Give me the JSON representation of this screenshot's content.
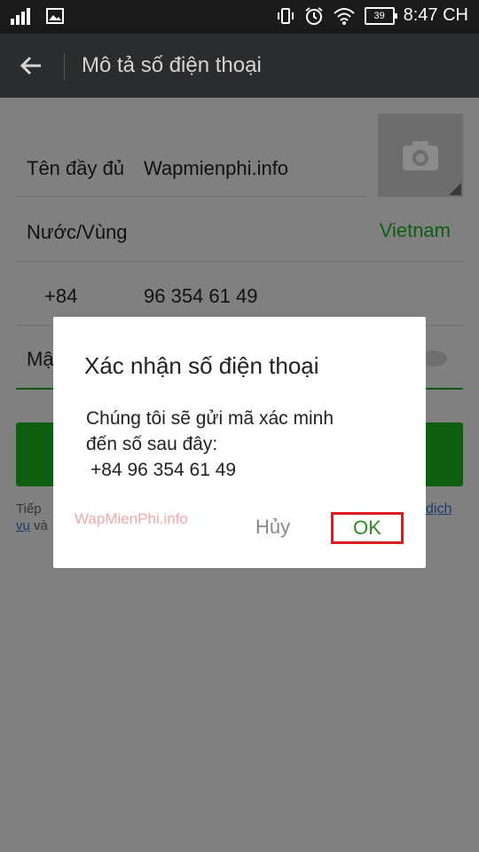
{
  "statusbar": {
    "time": "8:47 CH",
    "battery": "39",
    "icons": [
      "signal-icon",
      "image-icon",
      "vibrate-icon",
      "alarm-icon",
      "wifi-icon",
      "battery-icon"
    ]
  },
  "appbar": {
    "title": "Mô tả số điện thoại",
    "back_icon": "arrow-left-icon"
  },
  "form": {
    "fullname_label": "Tên đầy đủ",
    "fullname_value": "Wapmienphi.info",
    "country_label": "Nước/Vùng",
    "country_value": "Vietnam",
    "dial_code": "+84",
    "phone_value": "96 354 61 49",
    "password_label_partial": "Mậ",
    "terms_start": "Tiếp",
    "terms_link_end": "dịch",
    "terms_link_line2": "vụ",
    "terms_line2_after": "và"
  },
  "dialog": {
    "title": "Xác nhận số điện thoại",
    "message_line1": "Chúng tôi sẽ gửi mã xác minh",
    "message_line2": "đến số sau đây:",
    "phone": "+84 96 354 61 49",
    "watermark": "WapMienPhi.info",
    "cancel_label": "Hủy",
    "ok_label": "OK"
  },
  "colors": {
    "accent_green": "#1aad19",
    "highlight_red": "#d81e1e",
    "appbar": "#2b2c2e"
  }
}
